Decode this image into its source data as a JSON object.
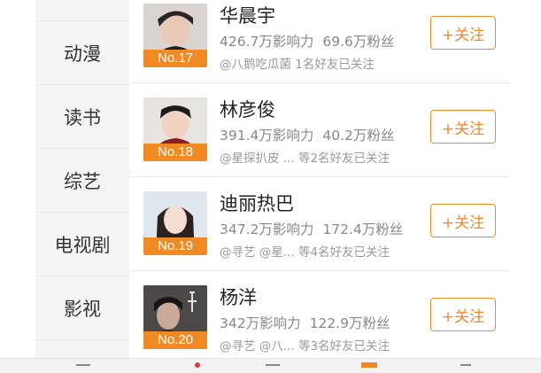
{
  "sidebar": {
    "items": [
      {
        "label": "动漫"
      },
      {
        "label": "读书"
      },
      {
        "label": "综艺"
      },
      {
        "label": "电视剧"
      },
      {
        "label": "影视"
      }
    ]
  },
  "list": {
    "follow_label": "+关注",
    "rows": [
      {
        "rank": "No.17",
        "name": "华晨宇",
        "influence": "426.7万影响力",
        "fans": "69.6万粉丝",
        "friends": "@八鹅吃瓜菌 1名好友已关注"
      },
      {
        "rank": "No.18",
        "name": "林彦俊",
        "influence": "391.4万影响力",
        "fans": "40.2万粉丝",
        "friends": "@星探扒皮 ... 等2名好友已关注"
      },
      {
        "rank": "No.19",
        "name": "迪丽热巴",
        "influence": "347.2万影响力",
        "fans": "172.4万粉丝",
        "friends": "@寻艺 @星... 等4名好友已关注"
      },
      {
        "rank": "No.20",
        "name": "杨洋",
        "influence": "342万影响力",
        "fans": "122.9万粉丝",
        "friends": "@寻艺 @八... 等3名好友已关注"
      }
    ]
  },
  "colors": {
    "accent": "#f08a24",
    "sidebar_bg": "#f4f4f4"
  },
  "icons": [
    "avatar-photo",
    "bottom-tab-icons"
  ]
}
